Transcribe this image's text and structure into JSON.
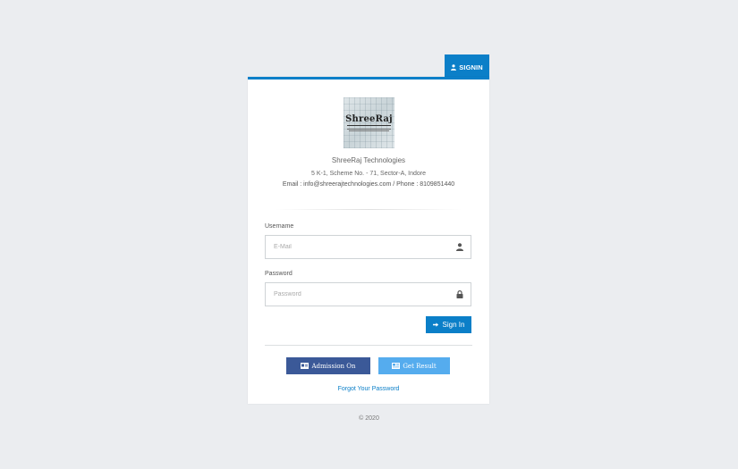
{
  "tab": {
    "label": "SIGNIN",
    "icon": "user-icon"
  },
  "org": {
    "logo_text": "ShreeRaj",
    "name": "ShreeRaj Technologies",
    "address": "5 K-1, Scheme No. - 71, Sector-A, Indore",
    "contact": "Email : info@shreerajtechnologies.com / Phone : 8109851440"
  },
  "form": {
    "username_label": "Username",
    "username_placeholder": "E-Mail",
    "username_icon": "user-icon",
    "password_label": "Password",
    "password_placeholder": "Password",
    "password_icon": "lock-icon",
    "signin_label": "Sign In",
    "signin_icon": "sign-in-icon"
  },
  "actions": {
    "admission_label": "Admission On",
    "admission_icon": "id-card-icon",
    "result_label": "Get Result",
    "result_icon": "newspaper-icon",
    "forgot_label": "Forgot Your Password"
  },
  "footer": {
    "copyright": "© 2020"
  },
  "colors": {
    "accent": "#0b7fc8",
    "background": "#ebedf0",
    "admission": "#3b5998",
    "result": "#55acee"
  }
}
